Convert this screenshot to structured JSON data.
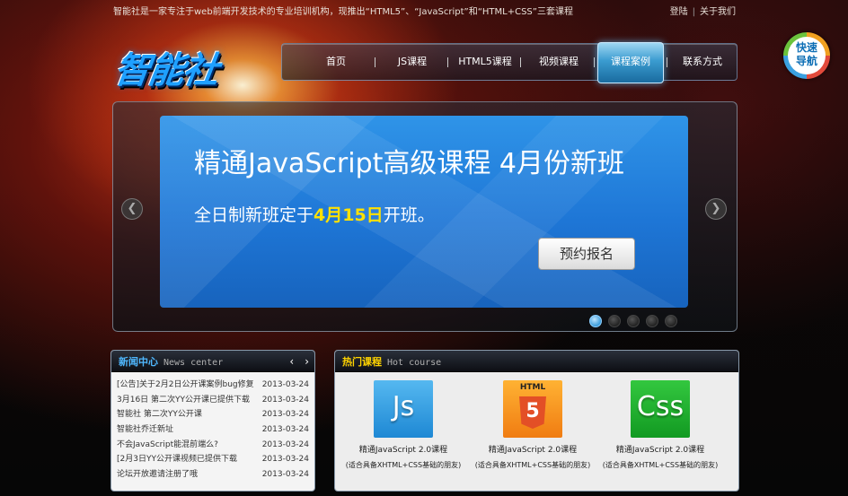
{
  "topbar": {
    "intro": "智能社是一家专注于web前端开发技术的专业培训机构，现推出“HTML5”、“JavaScript”和“HTML+CSS”三套课程",
    "login": "登陆",
    "about": "关于我们",
    "separator": "|"
  },
  "logo": {
    "text": "智能社"
  },
  "nav": {
    "items": [
      {
        "label": "首页"
      },
      {
        "label": "JS课程"
      },
      {
        "label": "HTML5课程"
      },
      {
        "label": "视频课程"
      },
      {
        "label": "课程案例"
      },
      {
        "label": "联系方式"
      }
    ],
    "active_index": 4,
    "separator": "|"
  },
  "quick_nav": {
    "line1": "快速",
    "line2": "导航"
  },
  "banner": {
    "title": "精通JavaScript高级课程 4月份新班",
    "subtitle_prefix": "全日制新班定于",
    "subtitle_date": "4月15日",
    "subtitle_suffix": "开班。",
    "button": "预约报名",
    "prev": "❮",
    "next": "❯",
    "slide_count": 5,
    "active_slide": 0
  },
  "news": {
    "title_cn": "新闻中心",
    "title_en": "News center",
    "prev": "‹",
    "next": "›",
    "items": [
      {
        "title": "[公告]关于2月2日公开课案例bug修复",
        "date": "2013-03-24"
      },
      {
        "title": "3月16日 第二次YY公开课已提供下载",
        "date": "2013-03-24"
      },
      {
        "title": "智能社 第二次YY公开课",
        "date": "2013-03-24"
      },
      {
        "title": "智能社乔迁新址",
        "date": "2013-03-24"
      },
      {
        "title": "不会JavaScript能混前端么?",
        "date": "2013-03-24"
      },
      {
        "title": "[2月3日YY公开课视频已提供下载",
        "date": "2013-03-24"
      },
      {
        "title": "论坛开放邀请注册了哦",
        "date": "2013-03-24"
      }
    ]
  },
  "hot": {
    "title_cn": "热门课程",
    "title_en": "Hot course",
    "courses": [
      {
        "icon": "js-icon",
        "icon_label": "Js",
        "name": "精通JavaScript 2.0课程",
        "note": "(适合具备XHTML+CSS基础的朋友)"
      },
      {
        "icon": "html5-icon",
        "icon_label": "HTML",
        "icon_num": "5",
        "name": "精通JavaScript 2.0课程",
        "note": "(适合具备XHTML+CSS基础的朋友)"
      },
      {
        "icon": "css-icon",
        "icon_label": "Css",
        "name": "精通JavaScript 2.0课程",
        "note": "(适合具备XHTML+CSS基础的朋友)"
      }
    ]
  }
}
